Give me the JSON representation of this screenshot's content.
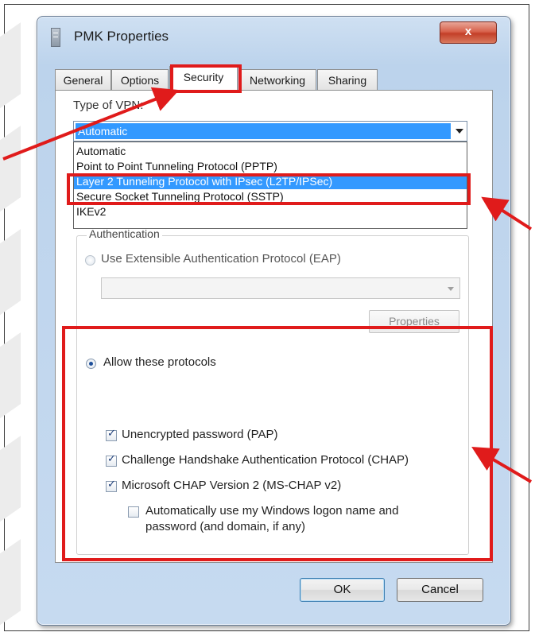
{
  "window": {
    "title": "PMK Properties",
    "close_label": "x"
  },
  "tabs": [
    "General",
    "Options",
    "Security",
    "Networking",
    "Sharing"
  ],
  "security": {
    "vpn_type_label": "Type of VPN:",
    "vpn_selected": "Automatic",
    "vpn_options": [
      "Automatic",
      "Point to Point Tunneling Protocol (PPTP)",
      "Layer 2 Tunneling Protocol with IPsec (L2TP/IPSec)",
      "Secure Socket Tunneling Protocol (SSTP)",
      "IKEv2"
    ],
    "highlighted_option_index": 2,
    "authentication": {
      "legend": "Authentication",
      "eap_label": "Use Extensible Authentication Protocol (EAP)",
      "properties_label": "Properties",
      "allow_label": "Allow these protocols",
      "protocols": [
        {
          "label": "Unencrypted password (PAP)",
          "checked": true
        },
        {
          "label": "Challenge Handshake Authentication Protocol (CHAP)",
          "checked": true
        },
        {
          "label": "Microsoft CHAP Version 2 (MS-CHAP v2)",
          "checked": true
        }
      ],
      "autologon_line1": "Automatically use my Windows logon name and",
      "autologon_line2": "password (and domain, if any)",
      "autologon_checked": false
    }
  },
  "buttons": {
    "ok": "OK",
    "cancel": "Cancel"
  },
  "colors": {
    "highlight": "#e01b1b",
    "selection": "#3399ff"
  }
}
